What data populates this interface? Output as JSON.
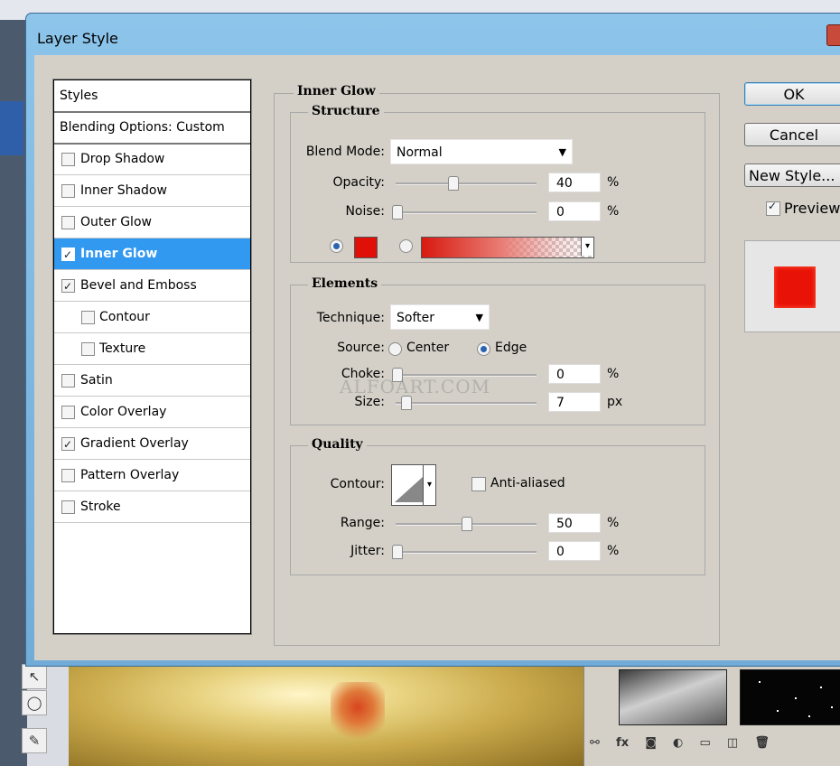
{
  "dialog": {
    "title": "Layer Style",
    "buttons": {
      "ok": "OK",
      "cancel": "Cancel",
      "new_style": "New Style...",
      "preview": "Preview"
    },
    "preview_checked": true
  },
  "styles": {
    "items": [
      {
        "label": "Styles",
        "checkbox": false,
        "checked": false,
        "indent": false,
        "selected": false,
        "header": true
      },
      {
        "label": "Blending Options: Custom",
        "checkbox": false,
        "checked": false,
        "indent": false,
        "selected": false,
        "header": true
      },
      {
        "label": "Drop Shadow",
        "checkbox": true,
        "checked": false,
        "indent": false,
        "selected": false
      },
      {
        "label": "Inner Shadow",
        "checkbox": true,
        "checked": false,
        "indent": false,
        "selected": false
      },
      {
        "label": "Outer Glow",
        "checkbox": true,
        "checked": false,
        "indent": false,
        "selected": false
      },
      {
        "label": "Inner Glow",
        "checkbox": true,
        "checked": true,
        "indent": false,
        "selected": true
      },
      {
        "label": "Bevel and Emboss",
        "checkbox": true,
        "checked": true,
        "indent": false,
        "selected": false
      },
      {
        "label": "Contour",
        "checkbox": true,
        "checked": false,
        "indent": true,
        "selected": false
      },
      {
        "label": "Texture",
        "checkbox": true,
        "checked": false,
        "indent": true,
        "selected": false
      },
      {
        "label": "Satin",
        "checkbox": true,
        "checked": false,
        "indent": false,
        "selected": false
      },
      {
        "label": "Color Overlay",
        "checkbox": true,
        "checked": false,
        "indent": false,
        "selected": false
      },
      {
        "label": "Gradient Overlay",
        "checkbox": true,
        "checked": true,
        "indent": false,
        "selected": false
      },
      {
        "label": "Pattern Overlay",
        "checkbox": true,
        "checked": false,
        "indent": false,
        "selected": false
      },
      {
        "label": "Stroke",
        "checkbox": true,
        "checked": false,
        "indent": false,
        "selected": false
      }
    ]
  },
  "inner_glow": {
    "title": "Inner Glow",
    "structure": {
      "title": "Structure",
      "blend_mode_label": "Blend Mode:",
      "blend_mode_value": "Normal",
      "opacity_label": "Opacity:",
      "opacity_value": "40",
      "opacity_unit": "%",
      "noise_label": "Noise:",
      "noise_value": "0",
      "noise_unit": "%",
      "color_selected": "solid",
      "color": "#e01008"
    },
    "elements": {
      "title": "Elements",
      "technique_label": "Technique:",
      "technique_value": "Softer",
      "source_label": "Source:",
      "source_center": "Center",
      "source_edge": "Edge",
      "source_selected": "Edge",
      "choke_label": "Choke:",
      "choke_value": "0",
      "choke_unit": "%",
      "size_label": "Size:",
      "size_value": "7",
      "size_unit": "px"
    },
    "quality": {
      "title": "Quality",
      "contour_label": "Contour:",
      "anti_aliased_label": "Anti-aliased",
      "anti_aliased": false,
      "range_label": "Range:",
      "range_value": "50",
      "range_unit": "%",
      "jitter_label": "Jitter:",
      "jitter_value": "0",
      "jitter_unit": "%"
    }
  },
  "watermark": "ALFOART.COM",
  "colors": {
    "selection": "#3299f0",
    "swatch": "#e01008",
    "dialog_frame": "#8cc4ea"
  }
}
